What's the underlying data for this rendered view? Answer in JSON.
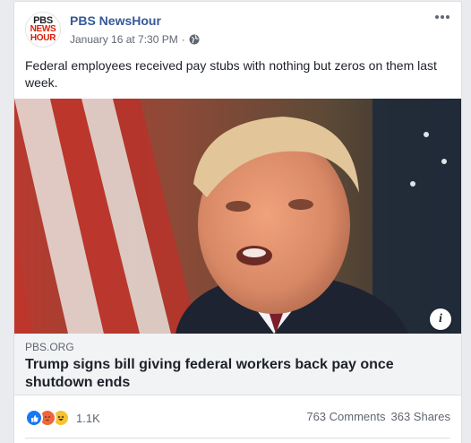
{
  "post": {
    "page_name": "PBS NewsHour",
    "logo": {
      "line1": "PBS",
      "line2": "NEWS",
      "line3": "HOUR"
    },
    "timestamp": "January 16 at 7:30 PM",
    "separator": "·",
    "privacy_icon": "globe-icon",
    "text": "Federal employees received pay stubs with nothing but zeros on them last week."
  },
  "link": {
    "domain": "PBS.ORG",
    "title": "Trump signs bill giving federal workers back pay once shutdown ends",
    "info_label": "i"
  },
  "stats": {
    "reactions": [
      "like",
      "angry",
      "haha"
    ],
    "reaction_count": "1.1K",
    "comments": "763 Comments",
    "shares": "363 Shares"
  },
  "colors": {
    "link_blue": "#365899",
    "pbs_red": "#d81e05",
    "like_blue": "#1877f2"
  }
}
